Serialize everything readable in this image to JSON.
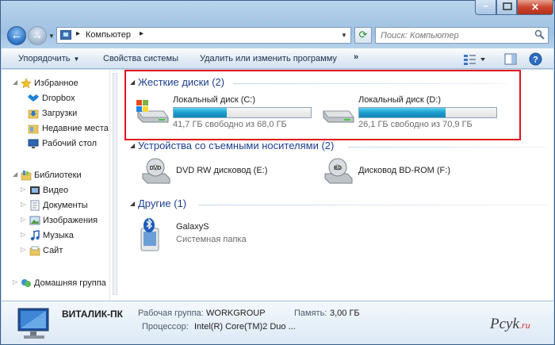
{
  "address": {
    "crumb": "Компьютер"
  },
  "search": {
    "placeholder": "Поиск: Компьютер"
  },
  "toolbar": {
    "organize": "Упорядочить",
    "system_props": "Свойства системы",
    "uninstall": "Удалить или изменить программу",
    "more": "»"
  },
  "sidebar": {
    "favorites": "Избранное",
    "dropbox": "Dropbox",
    "downloads": "Загрузки",
    "recent": "Недавние места",
    "desktop": "Рабочий стол",
    "libraries": "Библиотеки",
    "video": "Видео",
    "documents": "Документы",
    "pictures": "Изображения",
    "music": "Музыка",
    "site": "Сайт",
    "homegroup": "Домашняя группа"
  },
  "groups": {
    "hdd": "Жесткие диски (2)",
    "removable": "Устройства со съемными носителями (2)",
    "other": "Другие (1)"
  },
  "drives": {
    "c": {
      "name": "Локальный диск (C:)",
      "free": "41,7 ГБ свободно из 68,0 ГБ",
      "used_fraction": 0.387
    },
    "d": {
      "name": "Локальный диск (D:)",
      "free": "26,1 ГБ свободно из 70,9 ГБ",
      "used_fraction": 0.632
    }
  },
  "devices": {
    "dvd": "DVD RW дисковод (E:)",
    "bd": "Дисковод BD-ROM (F:)",
    "dvd_badge": "DVD",
    "bd_badge": "BD"
  },
  "other": {
    "name": "GalaxyS",
    "type": "Системная папка"
  },
  "details": {
    "computer": "ВИТАЛИК-ПК",
    "workgroup_label": "Рабочая группа:",
    "workgroup": "WORKGROUP",
    "memory_label": "Память:",
    "memory": "3,00 ГБ",
    "cpu_label": "Процессор:",
    "cpu": "Intel(R) Core(TM)2 Duo ..."
  },
  "watermark": {
    "text": "Pcyk",
    "suffix": ".ru"
  }
}
